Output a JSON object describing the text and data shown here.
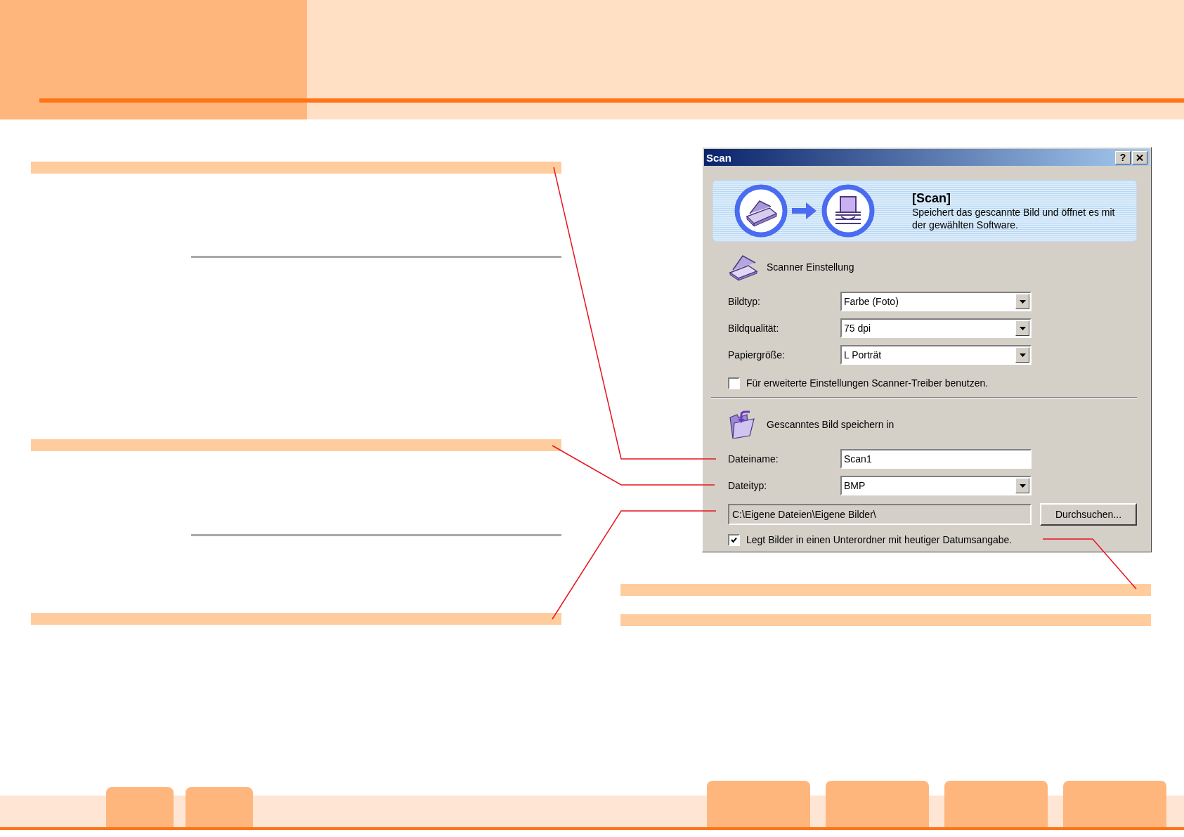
{
  "dialog": {
    "title": "Scan",
    "help_button": "?",
    "banner": {
      "heading": "[Scan]",
      "description": "Speichert das gescannte Bild und öffnet es mit der gewählten Software."
    },
    "scanner_section": {
      "heading": "Scanner Einstellung",
      "fields": [
        {
          "label": "Bildtyp:",
          "value": "Farbe (Foto)",
          "kind": "dropdown"
        },
        {
          "label": "Bildqualität:",
          "value": "75 dpi",
          "kind": "dropdown"
        },
        {
          "label": "Papiergröße:",
          "value": "L Porträt",
          "kind": "dropdown"
        }
      ],
      "option": {
        "label": "Für erweiterte Einstellungen Scanner-Treiber benutzen.",
        "checked": false
      }
    },
    "save_section": {
      "heading": "Gescanntes Bild speichern in",
      "fields": [
        {
          "label": "Dateiname:",
          "value": "Scan1",
          "kind": "text"
        },
        {
          "label": "Dateityp:",
          "value": "BMP",
          "kind": "dropdown"
        }
      ],
      "path": "C:\\Eigene Dateien\\Eigene Bilder\\",
      "browse_button": {
        "label": "Durchsuchen..."
      },
      "option": {
        "label": "Legt Bilder in einen Unterordner mit heutiger Datumsangabe.",
        "checked": true
      }
    }
  }
}
